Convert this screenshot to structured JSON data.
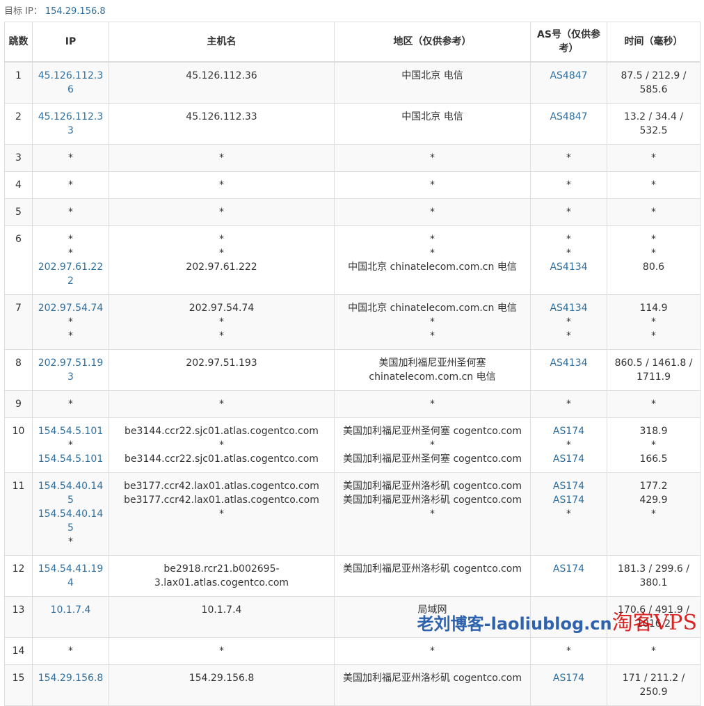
{
  "target": {
    "label": "目标 IP：",
    "ip": "154.29.156.8"
  },
  "headers": [
    "跳数",
    "IP",
    "主机名",
    "地区（仅供参考）",
    "AS号（仅供参考）",
    "时间（毫秒）"
  ],
  "rows": [
    {
      "hop": "1",
      "ip": [
        "45.126.112.36"
      ],
      "host": [
        "45.126.112.36"
      ],
      "region": [
        "中国北京 电信"
      ],
      "as": [
        "AS4847"
      ],
      "time": [
        "87.5 / 212.9 / 585.6"
      ]
    },
    {
      "hop": "2",
      "ip": [
        "45.126.112.33"
      ],
      "host": [
        "45.126.112.33"
      ],
      "region": [
        "中国北京 电信"
      ],
      "as": [
        "AS4847"
      ],
      "time": [
        "13.2 / 34.4 / 532.5"
      ]
    },
    {
      "hop": "3",
      "ip": [
        "*"
      ],
      "host": [
        "*"
      ],
      "region": [
        "*"
      ],
      "as": [
        "*"
      ],
      "time": [
        "*"
      ]
    },
    {
      "hop": "4",
      "ip": [
        "*"
      ],
      "host": [
        "*"
      ],
      "region": [
        "*"
      ],
      "as": [
        "*"
      ],
      "time": [
        "*"
      ]
    },
    {
      "hop": "5",
      "ip": [
        "*"
      ],
      "host": [
        "*"
      ],
      "region": [
        "*"
      ],
      "as": [
        "*"
      ],
      "time": [
        "*"
      ]
    },
    {
      "hop": "6",
      "ip": [
        "*",
        "*",
        "202.97.61.222"
      ],
      "host": [
        "*",
        "*",
        "202.97.61.222"
      ],
      "region": [
        "*",
        "*",
        "中国北京 chinatelecom.com.cn 电信"
      ],
      "as": [
        "*",
        "*",
        "AS4134"
      ],
      "time": [
        "*",
        "*",
        "80.6"
      ]
    },
    {
      "hop": "7",
      "ip": [
        "202.97.54.74",
        "*",
        "*"
      ],
      "host": [
        "202.97.54.74",
        "*",
        "*"
      ],
      "region": [
        "中国北京 chinatelecom.com.cn 电信",
        "*",
        "*"
      ],
      "as": [
        "AS4134",
        "*",
        "*"
      ],
      "time": [
        "114.9",
        "*",
        "*"
      ]
    },
    {
      "hop": "8",
      "ip": [
        "202.97.51.193"
      ],
      "host": [
        "202.97.51.193"
      ],
      "region": [
        "美国加利福尼亚州圣何塞 chinatelecom.com.cn 电信"
      ],
      "as": [
        "AS4134"
      ],
      "time": [
        "860.5 / 1461.8 / 1711.9"
      ]
    },
    {
      "hop": "9",
      "ip": [
        "*"
      ],
      "host": [
        "*"
      ],
      "region": [
        "*"
      ],
      "as": [
        "*"
      ],
      "time": [
        "*"
      ]
    },
    {
      "hop": "10",
      "ip": [
        "154.54.5.101",
        "*",
        "154.54.5.101"
      ],
      "host": [
        "be3144.ccr22.sjc01.atlas.cogentco.com",
        "*",
        "be3144.ccr22.sjc01.atlas.cogentco.com"
      ],
      "region": [
        "美国加利福尼亚州圣何塞 cogentco.com",
        "*",
        "美国加利福尼亚州圣何塞 cogentco.com"
      ],
      "as": [
        "AS174",
        "*",
        "AS174"
      ],
      "time": [
        "318.9",
        "*",
        "166.5"
      ]
    },
    {
      "hop": "11",
      "ip": [
        "154.54.40.145",
        "154.54.40.145",
        "*"
      ],
      "host": [
        "be3177.ccr42.lax01.atlas.cogentco.com",
        "be3177.ccr42.lax01.atlas.cogentco.com",
        "*"
      ],
      "region": [
        "美国加利福尼亚州洛杉矶 cogentco.com",
        "美国加利福尼亚州洛杉矶 cogentco.com",
        "*"
      ],
      "as": [
        "AS174",
        "AS174",
        "*"
      ],
      "time": [
        "177.2",
        "429.9",
        "*"
      ]
    },
    {
      "hop": "12",
      "ip": [
        "154.54.41.194"
      ],
      "host": [
        "be2918.rcr21.b002695-3.lax01.atlas.cogentco.com"
      ],
      "region": [
        "美国加利福尼亚州洛杉矶 cogentco.com"
      ],
      "as": [
        "AS174"
      ],
      "time": [
        "181.3 / 299.6 / 380.1"
      ]
    },
    {
      "hop": "13",
      "ip": [
        "10.1.7.4"
      ],
      "host": [
        "10.1.7.4"
      ],
      "region": [
        "局域网"
      ],
      "as": [
        ""
      ],
      "time": [
        "170.6 / 491.9 / 1016.2"
      ]
    },
    {
      "hop": "14",
      "ip": [
        "*"
      ],
      "host": [
        "*"
      ],
      "region": [
        "*"
      ],
      "as": [
        "*"
      ],
      "time": [
        "*"
      ]
    },
    {
      "hop": "15",
      "ip": [
        "154.29.156.8"
      ],
      "host": [
        "154.29.156.8"
      ],
      "region": [
        "美国加利福尼亚州洛杉矶 cogentco.com"
      ],
      "as": [
        "AS174"
      ],
      "time": [
        "171 / 211.2 / 250.9"
      ]
    }
  ],
  "watermark": {
    "text1": "老刘博客-laoliublog.cn",
    "text2": "淘客VPS"
  }
}
